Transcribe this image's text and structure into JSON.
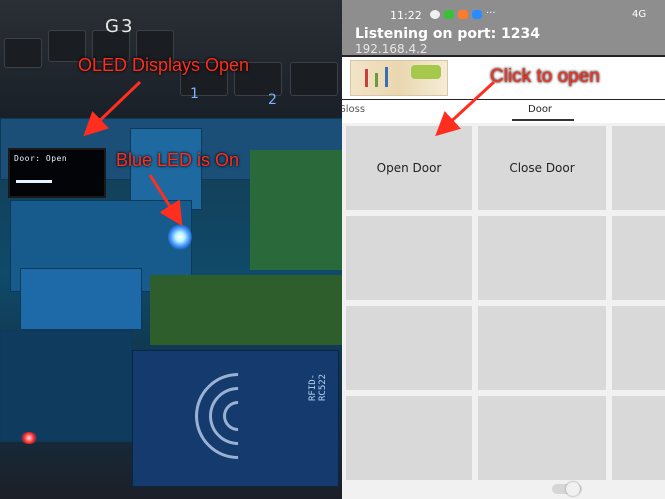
{
  "left_photo": {
    "keyboard_brand": "G3",
    "key_digits": [
      "1",
      "2"
    ],
    "oled_text": "Door: Open",
    "rfid_label": "RFID-RC522",
    "annotations": {
      "oled": "OLED Displays Open",
      "led": "Blue LED is On"
    },
    "annotation_color": "#ff2e1e"
  },
  "phone": {
    "status_time": "11:22",
    "status_dots": "···",
    "status_right": "4G",
    "listening": "Listening on port: 1234",
    "ip": "192.168.4.2",
    "click_annotation": "Click to open",
    "tabs": [
      {
        "label": "Gloss",
        "active": false
      },
      {
        "label": "Door",
        "active": true
      }
    ],
    "buttons": {
      "open_door": "Open Door",
      "close_door": "Close Door"
    },
    "accent_color": "#8e8e8e"
  }
}
